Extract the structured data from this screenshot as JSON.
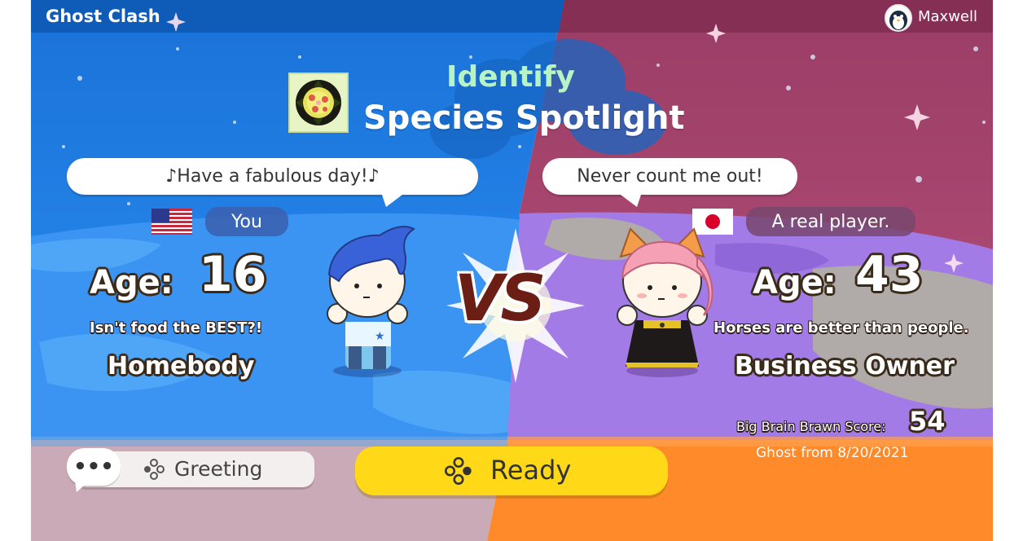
{
  "header": {
    "app_title": "Ghost Clash",
    "username": "Maxwell"
  },
  "mode": {
    "category": "Identify",
    "title": "Species Spotlight"
  },
  "player_left": {
    "speech": "♪Have a fabulous day!♪",
    "flag": "us-flag",
    "nickname": "You",
    "age_label": "Age:",
    "age": "16",
    "motto": "Isn't food the BEST?!",
    "title": "Homebody"
  },
  "player_right": {
    "speech": "Never count me out!",
    "flag": "jp-flag",
    "nickname": "A real player.",
    "age_label": "Age:",
    "age": "43",
    "motto": "Horses are better than people.",
    "title": "Business Owner",
    "score_label": "Big Brain Brawn Score:",
    "score": "54",
    "ghost_date": "Ghost from 8/20/2021"
  },
  "vs_label": "VS",
  "buttons": {
    "greeting": "Greeting",
    "ready": "Ready"
  },
  "colors": {
    "blue": "#1f7ee0",
    "magenta": "#a5466e",
    "yellow": "#ffd917",
    "orange": "#ff8a2a"
  }
}
